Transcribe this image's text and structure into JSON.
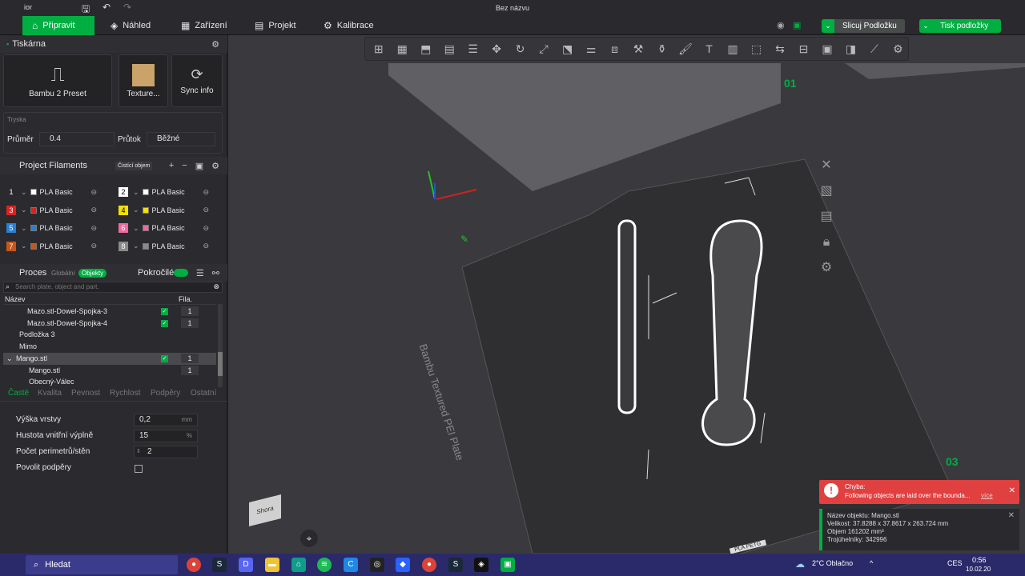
{
  "window": {
    "title": "Bez názvu",
    "app_fragment": "ior"
  },
  "menu": {
    "tabs": [
      {
        "label": "Připravit",
        "icon": "home-icon"
      },
      {
        "label": "Náhled",
        "icon": "cube-icon"
      },
      {
        "label": "Zařízení",
        "icon": "device-icon"
      },
      {
        "label": "Projekt",
        "icon": "project-icon"
      },
      {
        "label": "Kalibrace",
        "icon": "calibrate-icon"
      }
    ],
    "slice_button": "Slicuj Podložku",
    "print_button": "Tisk podložky"
  },
  "printer": {
    "header": "Tiskárna",
    "preset": "Bambu 2 Preset",
    "plate": "Texture...",
    "sync": "Sync info",
    "nozzle_header": "Tryska",
    "diameter_label": "Průměr",
    "diameter": "0.4",
    "flow_label": "Průtok",
    "flow": "Běžné"
  },
  "filaments": {
    "header": "Project Filaments",
    "clean_button": "Čistící objem",
    "items": [
      {
        "num": "1",
        "color": "#ffffff",
        "name": "PLA Basic"
      },
      {
        "num": "2",
        "color": "#ffffff",
        "name": "PLA Basic"
      },
      {
        "num": "3",
        "color": "#e02020",
        "name": "PLA Basic"
      },
      {
        "num": "4",
        "color": "#f5e000",
        "name": "PLA Basic"
      },
      {
        "num": "5",
        "color": "#2a7fd4",
        "name": "PLA Basic"
      },
      {
        "num": "6",
        "color": "#f06aa0",
        "name": "PLA Basic"
      },
      {
        "num": "7",
        "color": "#c8561a",
        "name": "PLA Basic"
      },
      {
        "num": "8",
        "color": "#8a8a8a",
        "name": "PLA Basic"
      }
    ]
  },
  "process": {
    "header": "Proces",
    "global": "Globální",
    "objects": "Objekty",
    "advanced": "Pokročilé",
    "search_placeholder": "Search plate, object and part.",
    "col_name": "Název",
    "col_fila": "Fila.",
    "tree": [
      {
        "name": "Mazo.stl-Dowel-Spojka-3",
        "fila": "1",
        "check": true
      },
      {
        "name": "Mazo.stl-Dowel-Spojka-4",
        "fila": "1",
        "check": true
      },
      {
        "name": "Podložka 3",
        "fila": "",
        "check": false
      },
      {
        "name": "Mimo",
        "fila": "",
        "check": false
      },
      {
        "name": "Mango.stl",
        "fila": "1",
        "check": true
      },
      {
        "name": "Mango.stl",
        "fila": "1",
        "check": false
      },
      {
        "name": "Obecný-Válec",
        "fila": "",
        "check": false
      }
    ],
    "tabs": [
      "Časté",
      "Kvalita",
      "Pevnost",
      "Rychlost",
      "Podpěry",
      "Ostatní"
    ],
    "params": [
      {
        "label": "Výška vrstvy",
        "value": "0,2",
        "unit": "mm"
      },
      {
        "label": "Hustota vnitřní výplně",
        "value": "15",
        "unit": "%"
      },
      {
        "label": "Počet perimetrů/stěn",
        "value": "2",
        "unit": ""
      },
      {
        "label": "Povolit podpěry",
        "value": "",
        "unit": ""
      }
    ]
  },
  "viewport": {
    "plate_label": "Bambu Textured PEI Plate",
    "plate_01": "01",
    "plate_03": "03",
    "view_cube": "Shora",
    "plate_text_bottom": "PLA PETG"
  },
  "error": {
    "title": "Chyba:",
    "message": "Following objects are laid over the bounda...",
    "link": "více"
  },
  "object_info": {
    "name": "Název objektu: Mango.stl",
    "size": "Velikost: 37.8288 x 37.8617 x 263.724 mm",
    "volume": "Objem 161202 mm³",
    "triangles": "Trojúhelníky: 342996"
  },
  "taskbar": {
    "search": "Hledat",
    "weather": "2°C Oblačno",
    "lang": "CES",
    "time": "0:56",
    "date": "10.02.20"
  }
}
